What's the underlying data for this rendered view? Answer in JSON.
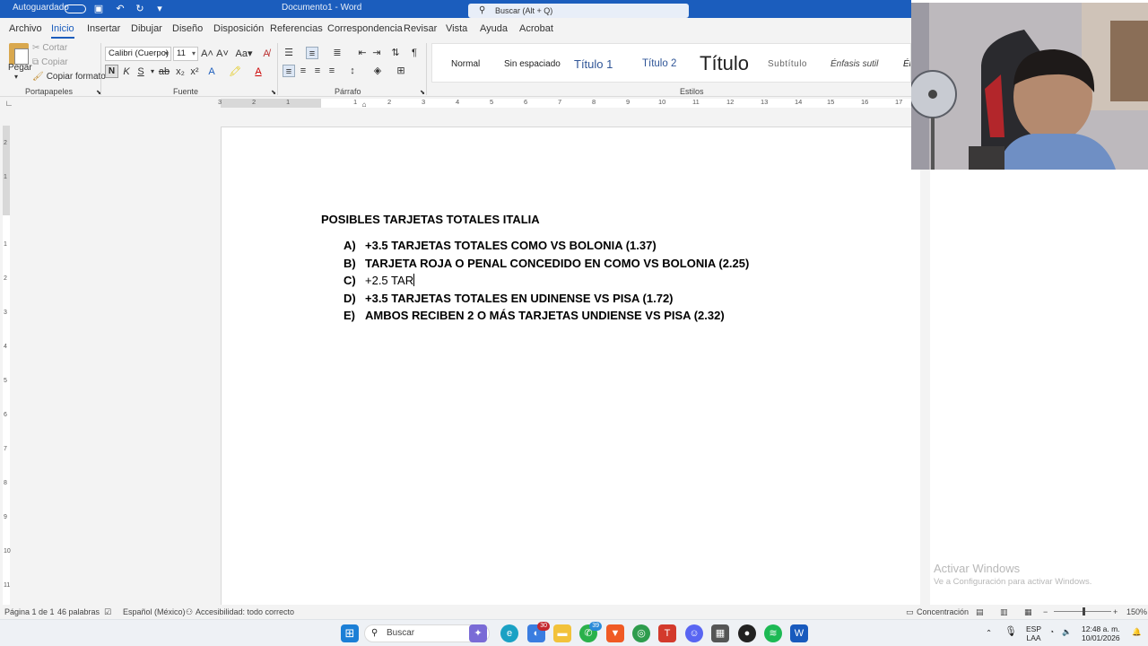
{
  "titlebar": {
    "autosave_label": "Autoguardado",
    "doc_title": "Documento1 - Word",
    "search_placeholder": "Buscar (Alt + Q)"
  },
  "menu": {
    "tabs": [
      "Archivo",
      "Inicio",
      "Insertar",
      "Dibujar",
      "Diseño",
      "Disposición",
      "Referencias",
      "Correspondencia",
      "Revisar",
      "Vista",
      "Ayuda",
      "Acrobat"
    ],
    "active": "Inicio"
  },
  "ribbon": {
    "clipboard": {
      "paste": "Pegar",
      "cut": "Cortar",
      "copy": "Copiar",
      "format_painter": "Copiar formato",
      "group_label": "Portapapeles"
    },
    "font": {
      "family": "Calibri (Cuerpo)",
      "size": "11",
      "bold": "N",
      "italic": "K",
      "underline": "S",
      "group_label": "Fuente"
    },
    "paragraph": {
      "group_label": "Párrafo"
    },
    "styles": {
      "items": [
        "Normal",
        "Sin espaciado",
        "Título 1",
        "Título 2",
        "Título",
        "Subtítulo",
        "Énfasis sutil",
        "Én"
      ],
      "group_label": "Estilos"
    }
  },
  "ruler": {
    "numbers": [
      "3",
      "2",
      "1",
      "1",
      "2",
      "3",
      "4",
      "5",
      "6",
      "7",
      "8",
      "9",
      "10",
      "11",
      "12",
      "13",
      "14",
      "15",
      "16",
      "17"
    ],
    "vertical_numbers": [
      "2",
      "1",
      "1",
      "2",
      "3",
      "4",
      "5",
      "6",
      "7",
      "8",
      "9",
      "10",
      "11"
    ]
  },
  "document": {
    "heading": "POSIBLES TARJETAS TOTALES ITALIA",
    "items": [
      {
        "letter": "A)",
        "text": "+3.5 TARJETAS TOTALES COMO VS BOLONIA (1.37)"
      },
      {
        "letter": "B)",
        "text": "TARJETA ROJA O PENAL CONCEDIDO EN COMO VS BOLONIA (2.25)"
      },
      {
        "letter": "C)",
        "text": "+2.5 TAR"
      },
      {
        "letter": "D)",
        "text": "+3.5 TARJETAS TOTALES EN UDINENSE VS PISA (1.72)"
      },
      {
        "letter": "E)",
        "text": "AMBOS RECIBEN 2 O MÁS TARJETAS UNDIENSE VS PISA (2.32)"
      }
    ]
  },
  "watermark": {
    "line1": "Activar Windows",
    "line2": "Ve a Configuración para activar Windows."
  },
  "statusbar": {
    "page": "Página 1 de 1",
    "words": "46 palabras",
    "language": "Español (México)",
    "accessibility": "Accesibilidad: todo correcto",
    "focus": "Concentración",
    "zoom": "150%"
  },
  "taskbar": {
    "search_label": "Buscar",
    "language": "ESP",
    "region": "LAA",
    "time": "12:48 a. m.",
    "date": "10/01/2026",
    "badge_1": "30",
    "badge_2": "39"
  },
  "colors": {
    "accent": "#1b5dbd",
    "ribbon_bg": "#f3f3f3",
    "word_blue": "#185abd"
  }
}
